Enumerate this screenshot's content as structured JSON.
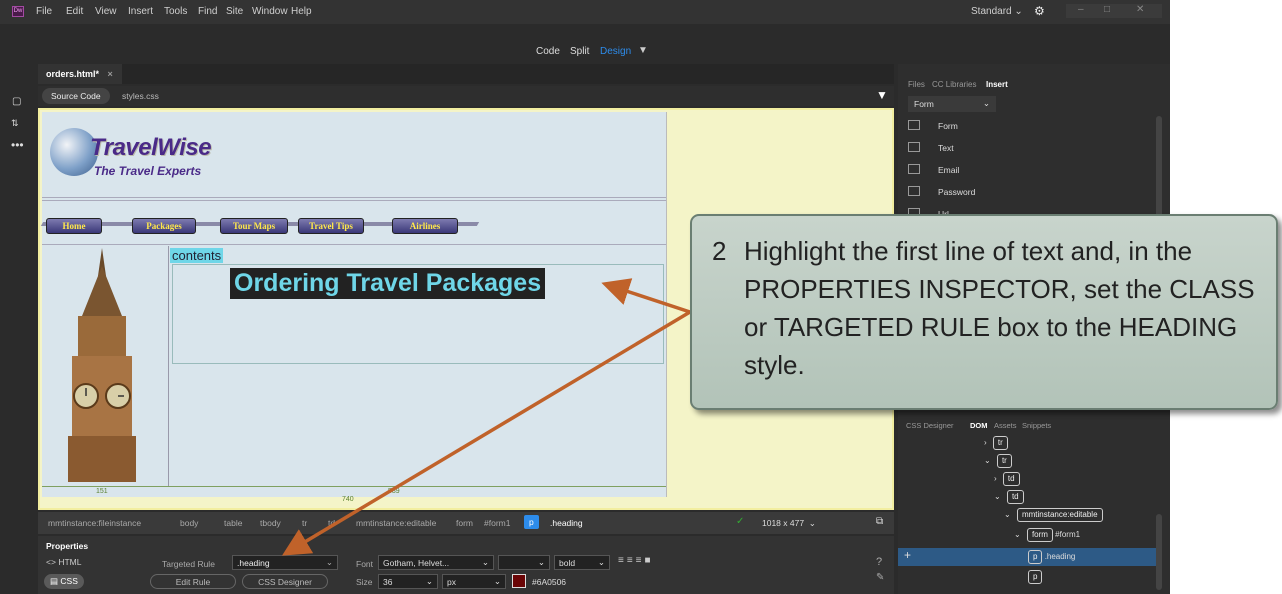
{
  "menu": {
    "items": [
      "File",
      "Edit",
      "View",
      "Insert",
      "Tools",
      "Find",
      "Site",
      "Window",
      "Help"
    ],
    "workspace": "Standard"
  },
  "viewbar": {
    "code": "Code",
    "split": "Split",
    "design": "Design"
  },
  "document": {
    "tab": "orders.html*",
    "source_code": "Source Code",
    "related_file": "styles.css"
  },
  "page": {
    "logo_title": "TravelWise",
    "logo_subtitle": "The Travel Experts",
    "nav": [
      "Home",
      "Packages",
      "Tour Maps",
      "Travel Tips",
      "Airlines"
    ],
    "region_label": "contents",
    "heading": "Ordering Travel Packages",
    "ruler_left": "151",
    "ruler_mid": "740",
    "ruler_right": "589"
  },
  "statusbar": {
    "crumbs": [
      "mmtinstance:fileinstance",
      "body",
      "table",
      "tbody",
      "tr",
      "td",
      "mmtinstance:editable",
      "form",
      "#form1",
      "p",
      ".heading"
    ],
    "window_size": "1018 x 477"
  },
  "properties": {
    "title": "Properties",
    "html_btn": "HTML",
    "css_btn": "CSS",
    "targeted_rule_label": "Targeted Rule",
    "targeted_rule_value": ".heading",
    "edit_rule": "Edit Rule",
    "css_designer": "CSS Designer",
    "font_label": "Font",
    "font_value": "Gotham, Helvet...",
    "weight_value": "bold",
    "size_label": "Size",
    "size_value": "36",
    "unit_value": "px",
    "color_value": "#6A0506"
  },
  "right_panel": {
    "tabs": [
      "Files",
      "CC Libraries",
      "Insert"
    ],
    "category": "Form",
    "items": [
      "Form",
      "Text",
      "Email",
      "Password",
      "Url"
    ],
    "bottom_tabs": [
      "CSS Designer",
      "DOM",
      "Assets",
      "Snippets"
    ],
    "dom": [
      {
        "tag": "tr",
        "label": ""
      },
      {
        "tag": "tr",
        "label": ""
      },
      {
        "tag": "td",
        "label": ""
      },
      {
        "tag": "td",
        "label": ""
      },
      {
        "tag": "mmtinstance:editable",
        "label": ""
      },
      {
        "tag": "form",
        "label": "#form1"
      },
      {
        "tag": "p",
        "label": ".heading"
      },
      {
        "tag": "p",
        "label": ""
      }
    ]
  },
  "callout": {
    "number": "2",
    "text": "Highlight the first line of text and, in the PROPERTIES INSPECTOR, set the CLASS or TARGETED RULE box to the HEADING style."
  },
  "colors": {
    "accent": "#2d8ceb",
    "arrow": "#c0622a",
    "heading_bg": "#222222",
    "heading_text": "#6fd6e8",
    "swatch": "#6A0506"
  }
}
